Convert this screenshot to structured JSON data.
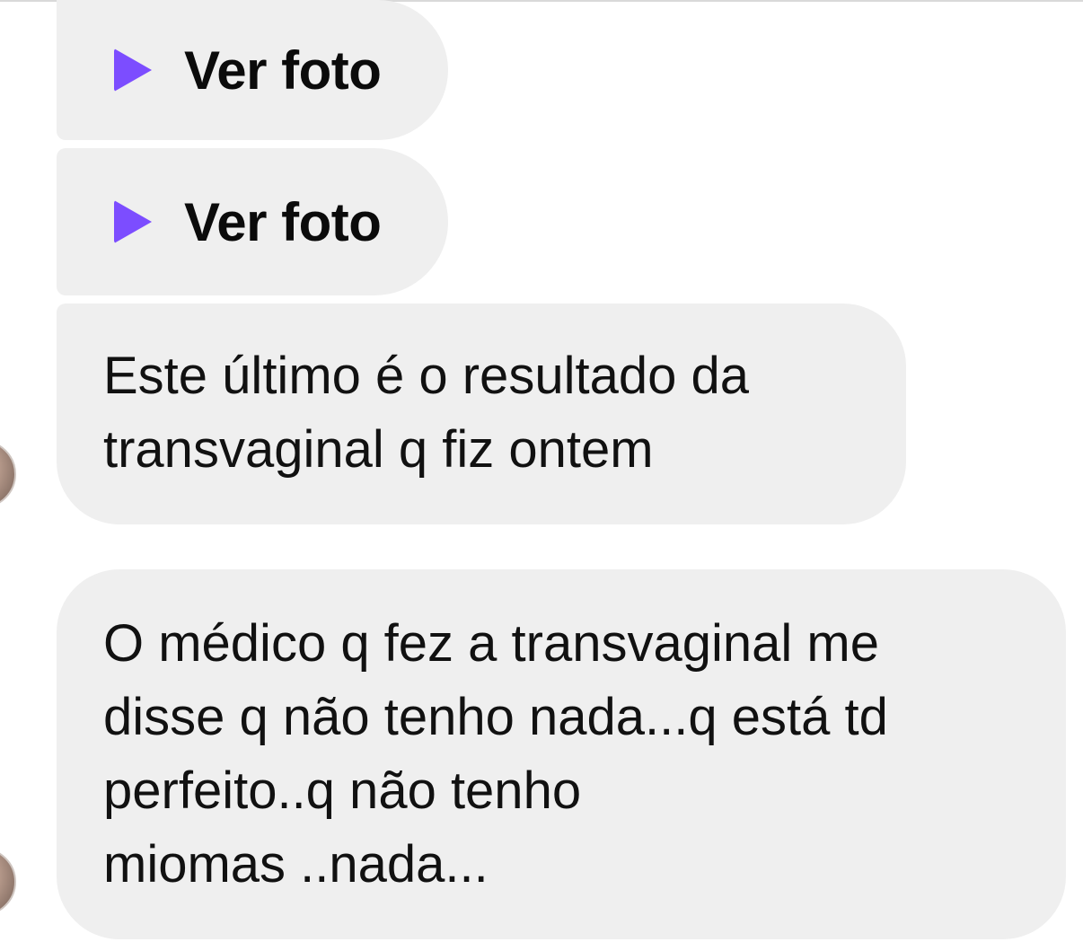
{
  "conversation": {
    "photo_messages": [
      {
        "icon": "play-icon",
        "label": "Ver foto"
      },
      {
        "icon": "play-icon",
        "label": "Ver foto"
      }
    ],
    "text_messages": [
      {
        "lines": [
          "Este último é o resultado da",
          "transvaginal q fiz ontem"
        ]
      },
      {
        "lines": [
          "O médico q fez a transvaginal me",
          "disse q não tenho nada...q está td",
          "perfeito..q não tenho",
          "miomas ..nada..."
        ]
      }
    ]
  },
  "colors": {
    "bubble_background": "#efefef",
    "accent_play": "#7c4dff",
    "text": "#111111"
  }
}
